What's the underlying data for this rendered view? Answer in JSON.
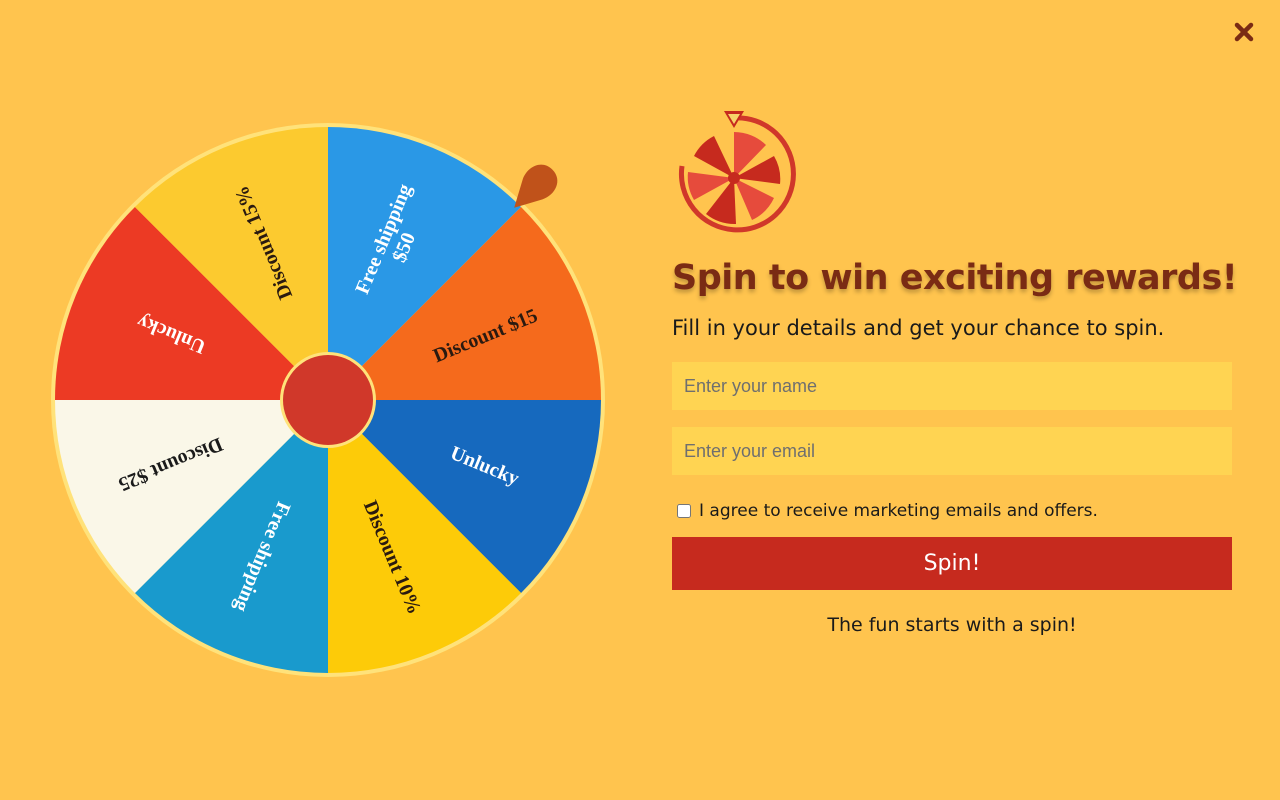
{
  "colors": {
    "background": "#FFC44E",
    "headline": "#7A2B14",
    "spin_button": "#C62A1E",
    "input_bg": "#FFD452",
    "pointer": "#C0521A",
    "hub": "#D0382A"
  },
  "close_icon": "close-icon",
  "wheel": {
    "segments": [
      {
        "label": "Free shipping\n$50",
        "color": "#2A98E6",
        "text_color": "#ffffff"
      },
      {
        "label": "Discount $15",
        "color": "#F56A1C",
        "text_color": "#2a1a10"
      },
      {
        "label": "Unlucky",
        "color": "#1669BE",
        "text_color": "#ffffff"
      },
      {
        "label": "Discount 10%",
        "color": "#FDCB08",
        "text_color": "#2a1a10"
      },
      {
        "label": "Free shipping",
        "color": "#199ACD",
        "text_color": "#ffffff"
      },
      {
        "label": "Discount $25",
        "color": "#FAF7E8",
        "text_color": "#1a1a1a"
      },
      {
        "label": "Unlucky",
        "color": "#EC3A24",
        "text_color": "#ffffff"
      },
      {
        "label": "Discount 15%",
        "color": "#FCCA2F",
        "text_color": "#2a1a10"
      }
    ]
  },
  "logo_icon": "prize-wheel-icon",
  "headline": "Spin to win exciting rewards!",
  "subhead": "Fill in your details and get your chance to spin.",
  "form": {
    "name_placeholder": "Enter your name",
    "email_placeholder": "Enter your email",
    "name_value": "",
    "email_value": "",
    "agree_label": "I agree to receive marketing emails and offers.",
    "agree_checked": false,
    "spin_label": "Spin!"
  },
  "footer": "The fun starts with a spin!"
}
